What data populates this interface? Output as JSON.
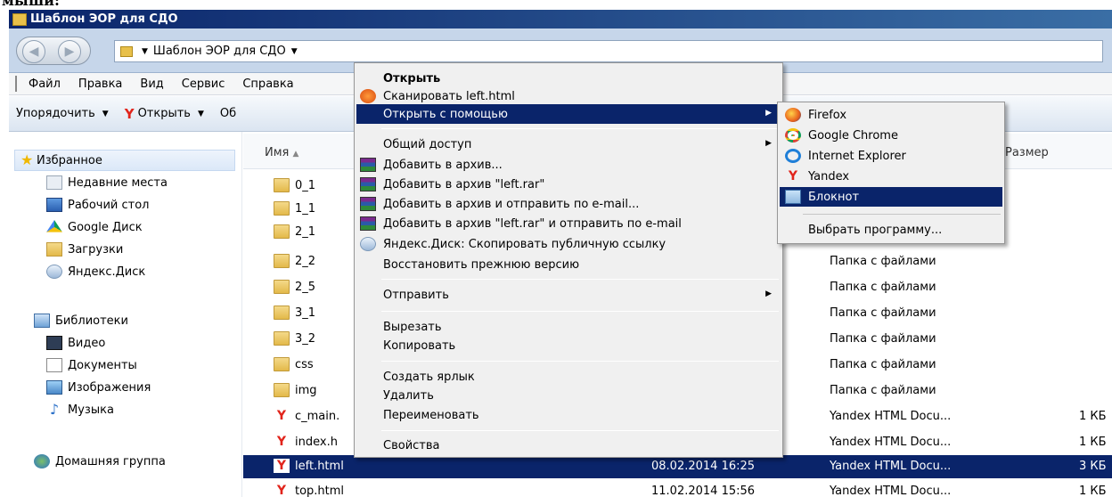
{
  "top_fragment": "мыши:",
  "window": {
    "title": "Шаблон ЭОР для СДО"
  },
  "address": {
    "path": "Шаблон ЭОР для СДО"
  },
  "menubar": [
    "Файл",
    "Правка",
    "Вид",
    "Сервис",
    "Справка"
  ],
  "toolbar": {
    "organize": "Упорядочить",
    "open": "Открыть",
    "share": "Об"
  },
  "sidebar": {
    "favorites": "Избранное",
    "fav_items": [
      "Недавние места",
      "Рабочий стол",
      "Google Диск",
      "Загрузки",
      "Яндекс.Диск"
    ],
    "libraries": "Библиотеки",
    "lib_items": [
      "Видео",
      "Документы",
      "Изображения",
      "Музыка"
    ],
    "homegroup": "Домашняя группа"
  },
  "columns": {
    "name": "Имя",
    "size": "Размер"
  },
  "files": [
    {
      "name": "0_1",
      "type": "",
      "date": "",
      "size": ""
    },
    {
      "name": "1_1",
      "type": "",
      "date": "",
      "size": ""
    },
    {
      "name": "2_1",
      "type": "",
      "date": "",
      "size": ""
    },
    {
      "name": "2_2",
      "type": "Папка с файлами",
      "date": "",
      "size": ""
    },
    {
      "name": "2_5",
      "type": "Папка с файлами",
      "date": "",
      "size": ""
    },
    {
      "name": "3_1",
      "type": "Папка с файлами",
      "date": "",
      "size": ""
    },
    {
      "name": "3_2",
      "type": "Папка с файлами",
      "date": "",
      "size": ""
    },
    {
      "name": "css",
      "type": "Папка с файлами",
      "date": "",
      "size": ""
    },
    {
      "name": "img",
      "type": "Папка с файлами",
      "date": "",
      "size": ""
    },
    {
      "name": "c_main.",
      "type": "Yandex HTML Docu...",
      "date": "",
      "size": "1 КБ"
    },
    {
      "name": "index.h",
      "type": "Yandex HTML Docu...",
      "date": "",
      "size": "1 КБ"
    },
    {
      "name": "left.html",
      "type": "Yandex HTML Docu...",
      "date": "08.02.2014 16:25",
      "size": "3 КБ"
    },
    {
      "name": "top.html",
      "type": "Yandex HTML Docu...",
      "date": "11.02.2014 15:56",
      "size": "1 КБ"
    }
  ],
  "context_menu": {
    "open": "Открыть",
    "scan": "Сканировать left.html",
    "open_with": "Открыть с помощью",
    "share": "Общий доступ",
    "add_archive": "Добавить в архив...",
    "add_rar": "Добавить в архив \"left.rar\"",
    "add_email": "Добавить в архив и отправить по e-mail...",
    "add_rar_email": "Добавить в архив \"left.rar\" и отправить по e-mail",
    "yadisk": "Яндекс.Диск: Скопировать публичную ссылку",
    "restore": "Восстановить прежнюю версию",
    "send_to": "Отправить",
    "cut": "Вырезать",
    "copy": "Копировать",
    "shortcut": "Создать ярлык",
    "delete": "Удалить",
    "rename": "Переименовать",
    "properties": "Свойства"
  },
  "open_with_menu": {
    "firefox": "Firefox",
    "chrome": "Google Chrome",
    "ie": "Internet Explorer",
    "yandex": "Yandex",
    "notepad": "Блокнот",
    "choose": "Выбрать программу..."
  }
}
